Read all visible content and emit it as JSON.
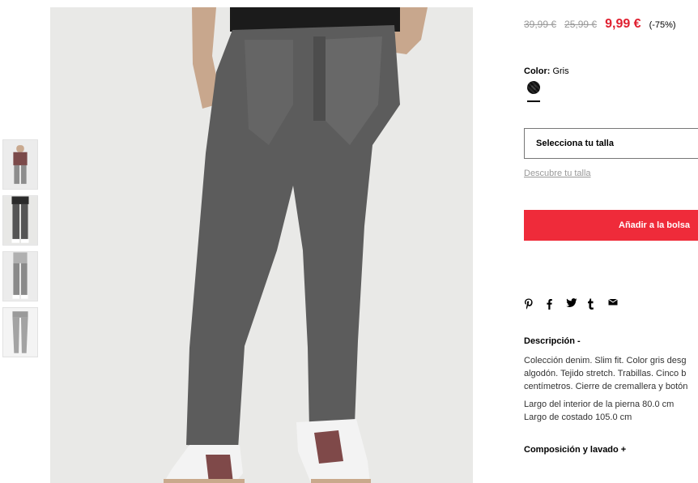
{
  "product": {
    "prices": {
      "original": "39,99 €",
      "previous": "25,99 €",
      "current": "9,99 €",
      "discount": "(-75%)",
      "sale_color": "#e02030"
    },
    "color": {
      "label": "Color:",
      "value": "Gris"
    },
    "size_select": {
      "placeholder": "Selecciona tu talla"
    },
    "size_guide_link": "Descubre tu talla",
    "add_to_bag": "Añadir a la bolsa",
    "accent_color": "#ef2b3a",
    "share_icons": [
      "pinterest-icon",
      "facebook-icon",
      "twitter-icon",
      "tumblr-icon",
      "email-icon"
    ],
    "description": {
      "title": "Descripción -",
      "lines": [
        "Colección denim. Slim fit. Color gris desg",
        "algodón. Tejido stretch. Trabillas. Cinco b",
        "centímetros. Cierre de cremallera y botón"
      ],
      "measurements": [
        "Largo del interior de la pierna 80.0 cm",
        "Largo de costado 105.0 cm"
      ]
    },
    "composition_title": "Composición y lavado +"
  },
  "gallery": {
    "thumbnails": [
      "thumb-1",
      "thumb-2",
      "thumb-3",
      "thumb-4"
    ],
    "active_thumbnail": 2
  }
}
